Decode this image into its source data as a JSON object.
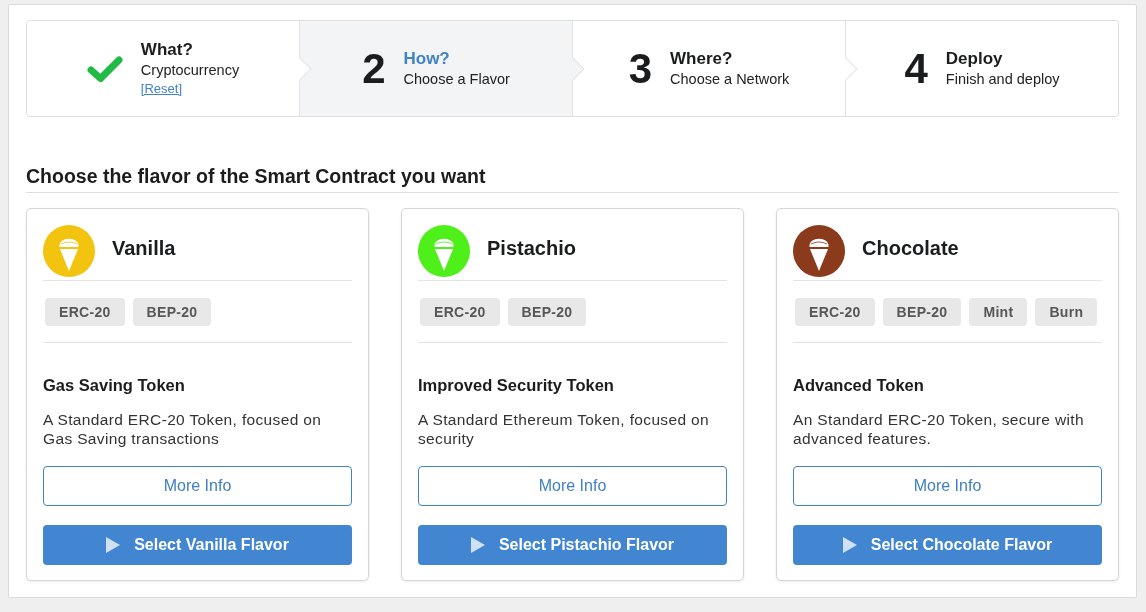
{
  "steps": [
    {
      "kind": "completed",
      "title": "What?",
      "subtitle": "Cryptocurrency",
      "link": "[Reset]",
      "selected": false
    },
    {
      "kind": "numbered",
      "number": "2",
      "title": "How?",
      "subtitle": "Choose a Flavor",
      "selected": true
    },
    {
      "kind": "numbered",
      "number": "3",
      "title": "Where?",
      "subtitle": "Choose a Network",
      "selected": false
    },
    {
      "kind": "numbered",
      "number": "4",
      "title": "Deploy",
      "subtitle": "Finish and deploy",
      "selected": false
    }
  ],
  "heading": "Choose the flavor of the Smart Contract you want",
  "flavors": [
    {
      "name": "Vanilla",
      "color": "#f2c40f",
      "tags": [
        "ERC-20",
        "BEP-20"
      ],
      "title": "Gas Saving Token",
      "description": "A Standard ERC-20 Token, focused on Gas Saving transactions",
      "info_button": "More Info",
      "select_button": "Select Vanilla Flavor"
    },
    {
      "name": "Pistachio",
      "color": "#4ff01a",
      "tags": [
        "ERC-20",
        "BEP-20"
      ],
      "title": "Improved Security Token",
      "description": "A Standard Ethereum Token, focused on security",
      "info_button": "More Info",
      "select_button": "Select Pistachio Flavor"
    },
    {
      "name": "Chocolate",
      "color": "#8b3a1c",
      "tags": [
        "ERC-20",
        "BEP-20",
        "Mint",
        "Burn"
      ],
      "title": "Advanced Token",
      "description": "An Standard ERC-20 Token, secure with advanced features.",
      "info_button": "More Info",
      "select_button": "Select Chocolate Flavor"
    }
  ]
}
